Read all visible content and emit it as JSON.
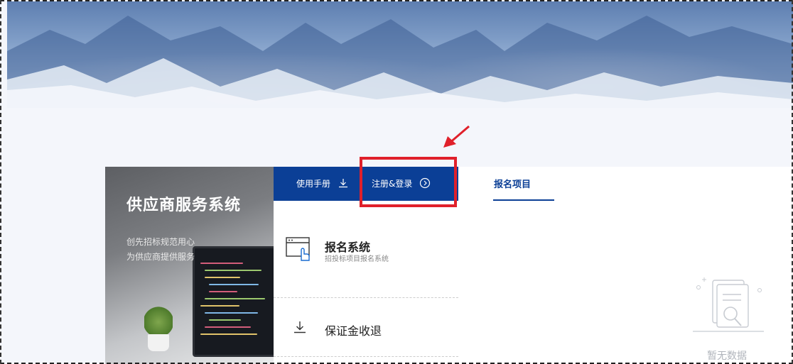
{
  "banner": {
    "image": "mountain-landscape"
  },
  "supplier_panel": {
    "title": "供应商服务系统",
    "subtitle_line1": "创先招标规范用心",
    "subtitle_line2": "为供应商提供服务"
  },
  "menu": {
    "manual_label": "使用手册",
    "register_login_label": "注册&登录",
    "items": [
      {
        "title": "报名系统",
        "desc": "招投标项目报名系统",
        "icon": "browser-click-icon"
      },
      {
        "title": "保证金收退",
        "icon": "download-icon"
      }
    ]
  },
  "project_tab": {
    "label": "报名项目"
  },
  "empty_state": {
    "text": "暂无数据",
    "icon": "document-search-icon"
  },
  "annotation": {
    "highlight_color": "#e0202a",
    "arrow_color": "#e0202a"
  },
  "colors": {
    "primary": "#0b3f96",
    "page_bg": "#f4f6fb"
  }
}
